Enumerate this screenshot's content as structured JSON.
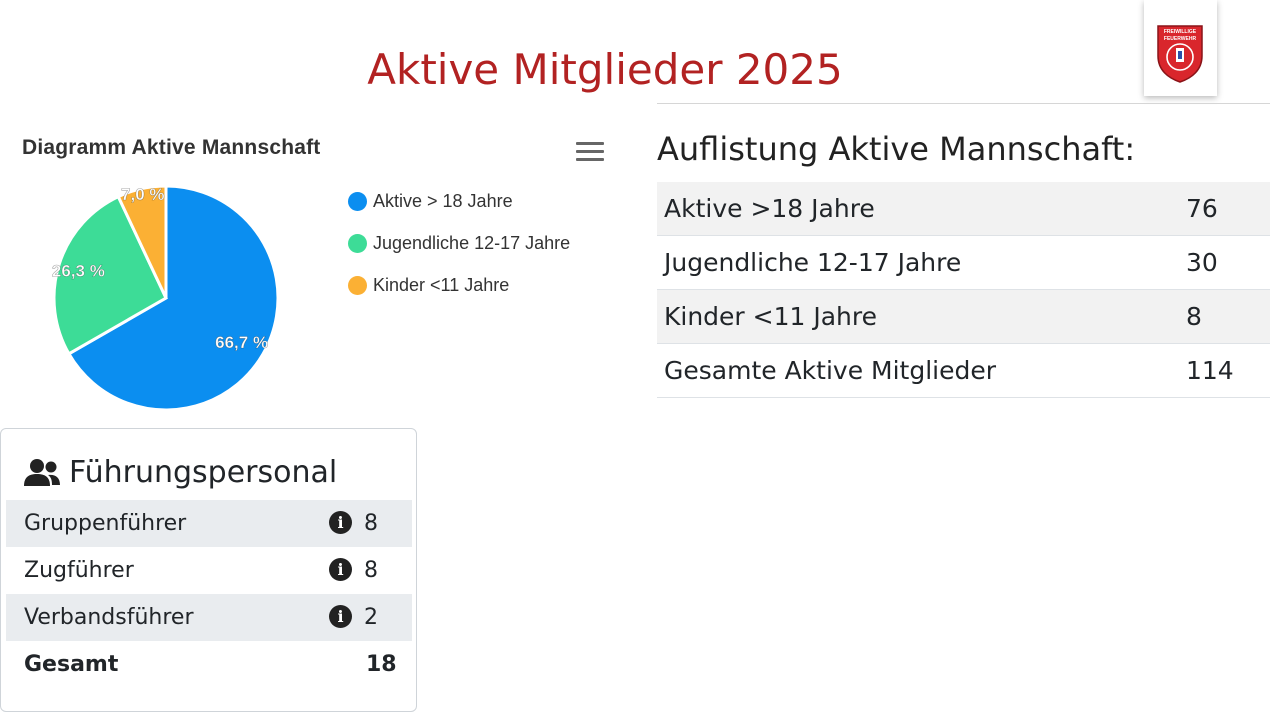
{
  "page": {
    "title": "Aktive Mitglieder 2025"
  },
  "logo": {
    "text_lines": [
      "FREIWILLIGE",
      "FEUERWEHR"
    ]
  },
  "chart": {
    "title": "Diagramm Aktive Mannschaft",
    "menu_icon": "hamburger-menu-icon"
  },
  "chart_data": {
    "type": "pie",
    "title": "Diagramm Aktive Mannschaft",
    "categories": [
      "Aktive > 18 Jahre",
      "Jugendliche 12-17 Jahre",
      "Kinder <11 Jahre"
    ],
    "values": [
      66.7,
      26.3,
      7.0
    ],
    "value_labels": [
      "66,7 %",
      "26,3 %",
      "7,0 %"
    ],
    "colors": [
      "#0b8ef0",
      "#3ddc97",
      "#fbb034"
    ],
    "legend_position": "right"
  },
  "leadership": {
    "icon": "users-icon",
    "title": "Führungspersonal",
    "rows": [
      {
        "label": "Gruppenführer",
        "value": "8",
        "icon": "info-icon"
      },
      {
        "label": "Zugführer",
        "value": "8",
        "icon": "info-icon"
      },
      {
        "label": "Verbandsführer",
        "value": "2",
        "icon": "info-icon"
      }
    ],
    "total": {
      "label": "Gesamt",
      "value": "18"
    }
  },
  "listing": {
    "title": "Auflistung Aktive Mannschaft:",
    "rows": [
      {
        "label": "Aktive >18 Jahre",
        "value": "76"
      },
      {
        "label": "Jugendliche 12-17 Jahre",
        "value": "30"
      },
      {
        "label": "Kinder <11 Jahre",
        "value": "8"
      },
      {
        "label": "Gesamte Aktive Mitglieder",
        "value": "114"
      }
    ]
  }
}
